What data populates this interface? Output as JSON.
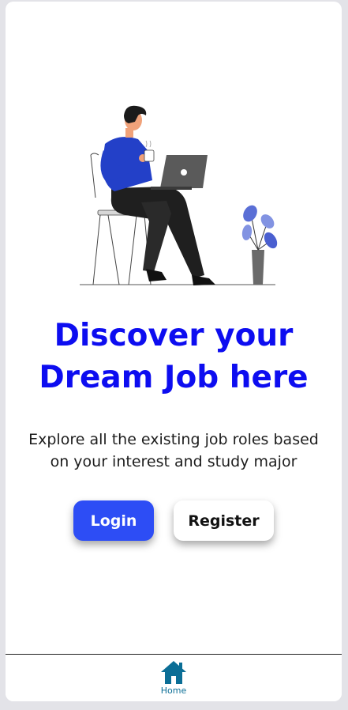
{
  "hero": {
    "illustration": "person-with-laptop-illustration",
    "title_line1": "Discover your",
    "title_line2": "Dream Job here",
    "subtitle": "Explore all the existing job roles based on your interest and study major"
  },
  "actions": {
    "login_label": "Login",
    "register_label": "Register"
  },
  "bottom_nav": {
    "items": [
      {
        "label": "Home",
        "icon": "home-icon"
      }
    ]
  },
  "colors": {
    "title": "#0d0df0",
    "login_button": "#2d4df5",
    "nav_accent": "#0b6e96"
  }
}
